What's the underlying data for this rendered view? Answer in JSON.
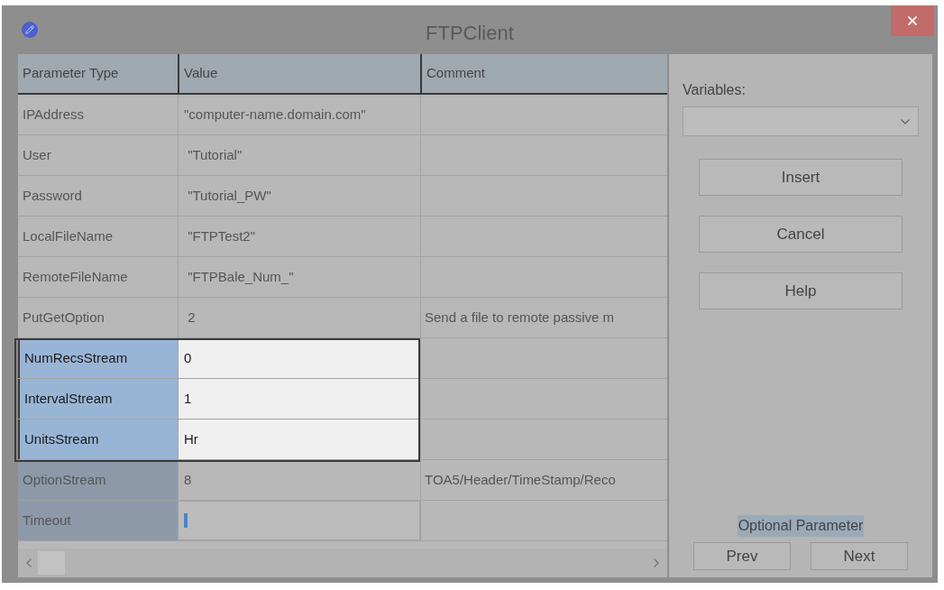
{
  "window": {
    "title": "FTPClient"
  },
  "table": {
    "columns": [
      "Parameter Type",
      "Value",
      "Comment"
    ],
    "rows": [
      {
        "parameter": "IPAddress",
        "value": "\"computer-name.domain.com\"",
        "comment": "",
        "highlighted": false,
        "optional": false,
        "editing": false
      },
      {
        "parameter": "User",
        "value": " \"Tutorial\"",
        "comment": "",
        "highlighted": false,
        "optional": false,
        "editing": false
      },
      {
        "parameter": "Password",
        "value": " \"Tutorial_PW\"",
        "comment": "",
        "highlighted": false,
        "optional": false,
        "editing": false
      },
      {
        "parameter": "LocalFileName",
        "value": " \"FTPTest2\"",
        "comment": "",
        "highlighted": false,
        "optional": false,
        "editing": false
      },
      {
        "parameter": "RemoteFileName",
        "value": " \"FTPBale_Num_\"",
        "comment": "",
        "highlighted": false,
        "optional": false,
        "editing": false
      },
      {
        "parameter": "PutGetOption",
        "value": " 2",
        "comment": "Send a file to remote passive m",
        "highlighted": false,
        "optional": false,
        "editing": false
      },
      {
        "parameter": "NumRecsStream",
        "value": "0",
        "comment": "",
        "highlighted": true,
        "optional": false,
        "editing": false
      },
      {
        "parameter": "IntervalStream",
        "value": "1",
        "comment": "",
        "highlighted": true,
        "optional": false,
        "editing": false
      },
      {
        "parameter": "UnitsStream",
        "value": "Hr",
        "comment": "",
        "highlighted": true,
        "optional": false,
        "editing": false
      },
      {
        "parameter": "OptionStream",
        "value": "8",
        "comment": "TOA5/Header/TimeStamp/Reco",
        "highlighted": false,
        "optional": true,
        "editing": false
      },
      {
        "parameter": "Timeout",
        "value": "",
        "comment": "",
        "highlighted": false,
        "optional": true,
        "editing": true
      }
    ]
  },
  "side_panel": {
    "variables_label": "Variables:",
    "buttons": [
      "Insert",
      "Cancel",
      "Help"
    ],
    "status": "Optional Parameter",
    "nav_buttons": [
      "Prev",
      "Next"
    ]
  }
}
